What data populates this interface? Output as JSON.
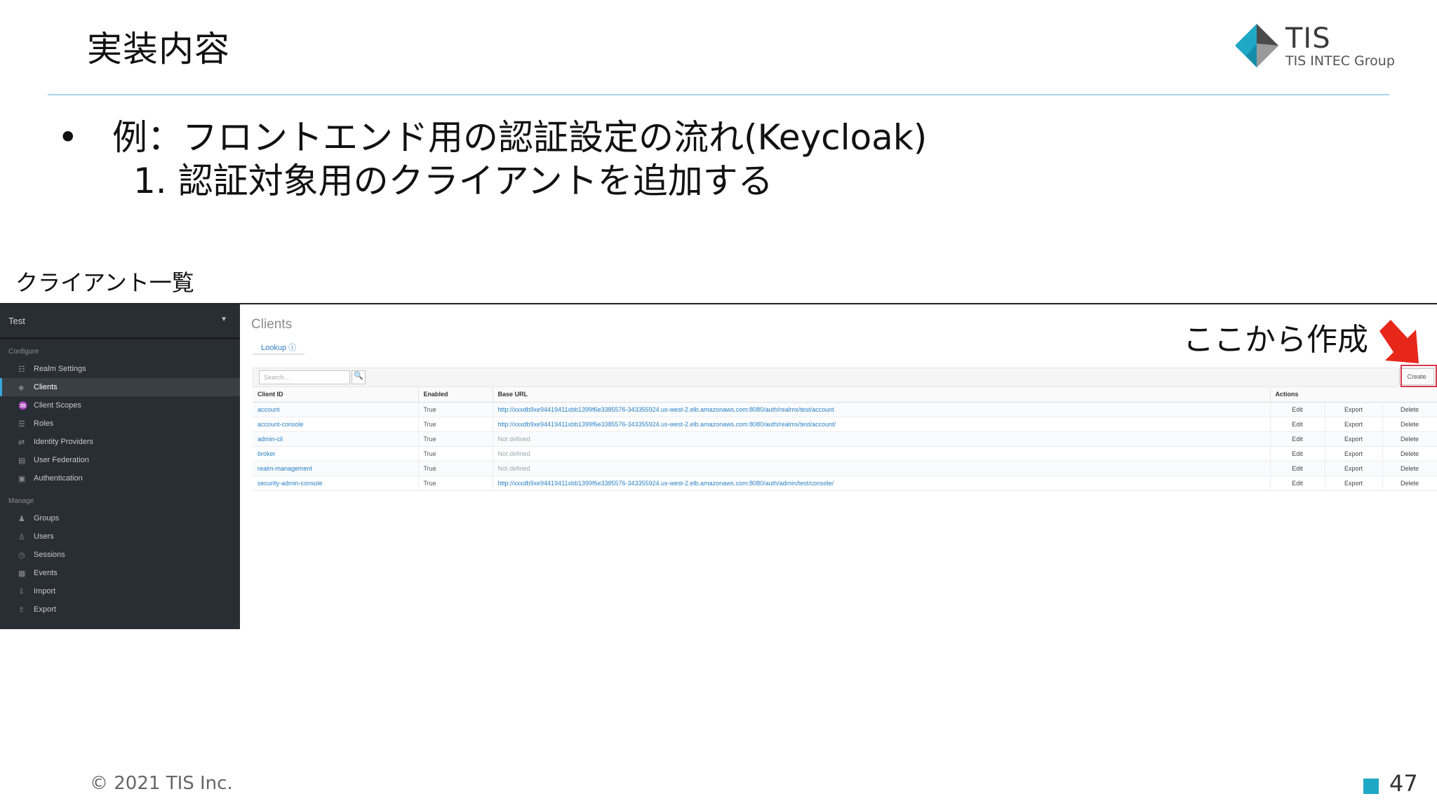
{
  "slide": {
    "title": "実装内容",
    "bullet": "•",
    "bullet_text": "例：フロントエンド用の認証設定の流れ(Keycloak)",
    "sub_text": "1.  認証対象用のクライアントを追加する",
    "section_label": "クライアント一覧",
    "annotation": "ここから作成",
    "copyright": "© 2021 TIS Inc.",
    "page_number": "47"
  },
  "logo": {
    "name": "TIS",
    "sub": "TIS INTEC Group",
    "colors": {
      "teal": "#1fa8c6",
      "dark": "#4a4a4a",
      "gray": "#9a9a9a"
    }
  },
  "keycloak": {
    "realm": "Test",
    "configure_label": "Configure",
    "configure_items": [
      {
        "label": "Realm Settings",
        "icon": "sliders-icon",
        "glyph": "☷"
      },
      {
        "label": "Clients",
        "icon": "cube-icon",
        "glyph": "◈",
        "active": true
      },
      {
        "label": "Client Scopes",
        "icon": "scopes-icon",
        "glyph": "♒"
      },
      {
        "label": "Roles",
        "icon": "roles-icon",
        "glyph": "☰"
      },
      {
        "label": "Identity Providers",
        "icon": "exchange-icon",
        "glyph": "⇄"
      },
      {
        "label": "User Federation",
        "icon": "database-icon",
        "glyph": "▤"
      },
      {
        "label": "Authentication",
        "icon": "lock-icon",
        "glyph": "▣"
      }
    ],
    "manage_label": "Manage",
    "manage_items": [
      {
        "label": "Groups",
        "icon": "users-icon",
        "glyph": "♟"
      },
      {
        "label": "Users",
        "icon": "user-icon",
        "glyph": "♙"
      },
      {
        "label": "Sessions",
        "icon": "clock-icon",
        "glyph": "◷"
      },
      {
        "label": "Events",
        "icon": "calendar-icon",
        "glyph": "▦"
      },
      {
        "label": "Import",
        "icon": "import-icon",
        "glyph": "⇩"
      },
      {
        "label": "Export",
        "icon": "export-icon",
        "glyph": "⇧"
      }
    ],
    "heading": "Clients",
    "tab": "Lookup ⓘ",
    "search_placeholder": "Search...",
    "search_icon": "🔍",
    "create_label": "Create",
    "columns": [
      "Client ID",
      "Enabled",
      "Base URL",
      "Actions"
    ],
    "rows": [
      {
        "client_id": "account",
        "enabled": "True",
        "base_url": "http://xxxdb9xe94419411xbb1399f6e3385576-343355924.us-west-2.elb.amazonaws.com:8080/auth/realms/test/account",
        "edit": "Edit",
        "export": "Export",
        "delete": "Delete"
      },
      {
        "client_id": "account-console",
        "enabled": "True",
        "base_url": "http://xxxdb9xe94419411xbb1399f6e3385576-343355924.us-west-2.elb.amazonaws.com:8080/auth/realms/test/account/",
        "edit": "Edit",
        "export": "Export",
        "delete": "Delete"
      },
      {
        "client_id": "admin-cli",
        "enabled": "True",
        "base_url": "Not defined",
        "edit": "Edit",
        "export": "Export",
        "delete": "Delete"
      },
      {
        "client_id": "broker",
        "enabled": "True",
        "base_url": "Not defined",
        "edit": "Edit",
        "export": "Export",
        "delete": "Delete"
      },
      {
        "client_id": "realm-management",
        "enabled": "True",
        "base_url": "Not defined",
        "edit": "Edit",
        "export": "Export",
        "delete": "Delete"
      },
      {
        "client_id": "security-admin-console",
        "enabled": "True",
        "base_url": "http://xxxdb9xe94419411xbb1399f6e3385576-343355924.us-west-2.elb.amazonaws.com:8080/auth/admin/test/console/",
        "edit": "Edit",
        "export": "Export",
        "delete": "Delete"
      }
    ],
    "colors": {
      "sidebar": "#292e34",
      "link": "#2a81c4",
      "active_bar": "#39a5dc",
      "highlight": "#d9384c",
      "arrow": "#e8271b"
    }
  }
}
